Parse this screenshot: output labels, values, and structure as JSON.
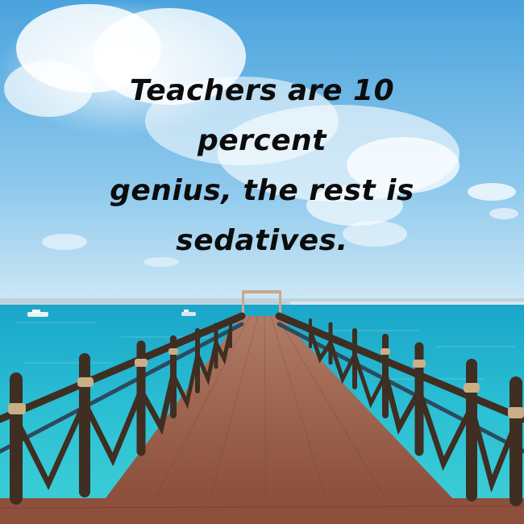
{
  "quote": {
    "lines": [
      "Teachers are 10 percent",
      "genius, the rest is",
      "sedatives."
    ]
  },
  "colors": {
    "sky_top": "#4aa3dd",
    "sky_bottom": "#cfe8f6",
    "sea_far": "#1fb2d0",
    "sea_near": "#33c7d3",
    "deck": "#9a5a45",
    "rail_wood": "#3f2e22",
    "rope": "#c9b089",
    "text": "#0c0c0c"
  }
}
